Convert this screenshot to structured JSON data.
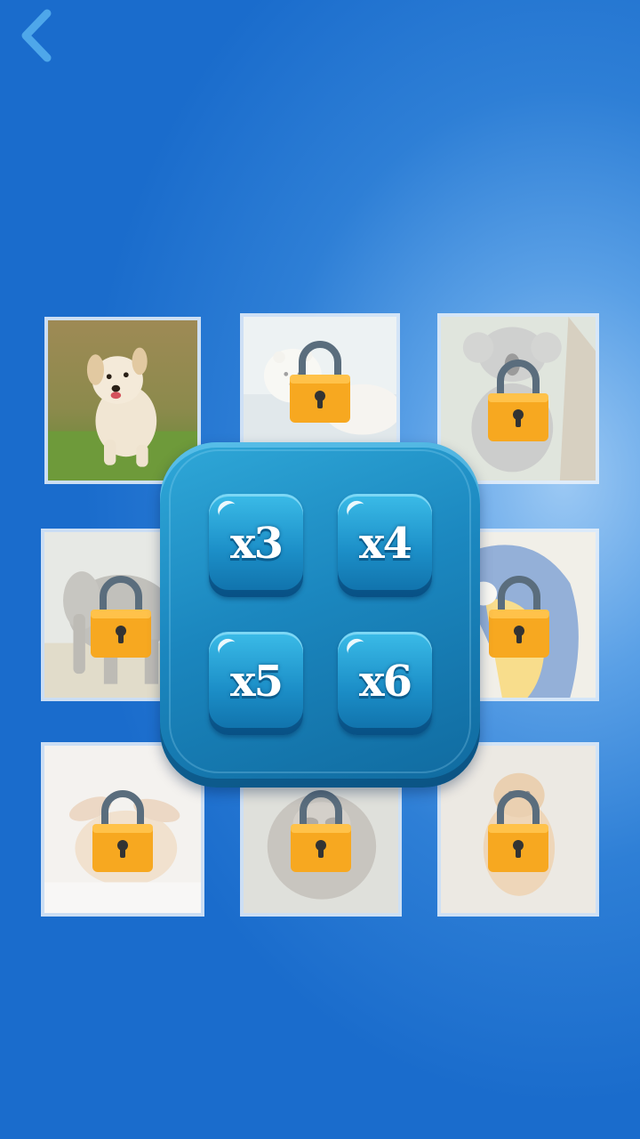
{
  "colors": {
    "background": "#2e7fd6",
    "panel": "#1b87bf",
    "button": "#1c8fc8",
    "lock_body": "#f7a820",
    "lock_shackle": "#5a6d7d"
  },
  "nav": {
    "back_icon": "chevron-left-icon"
  },
  "puzzles": [
    {
      "animal": "puppy",
      "locked": false
    },
    {
      "animal": "polar-bear",
      "locked": true
    },
    {
      "animal": "koala",
      "locked": true
    },
    {
      "animal": "elephant",
      "locked": true
    },
    {
      "animal": "hidden",
      "locked": true
    },
    {
      "animal": "parrot",
      "locked": true
    },
    {
      "animal": "bunny",
      "locked": true
    },
    {
      "animal": "raccoon",
      "locked": true
    },
    {
      "animal": "tiger-cub",
      "locked": true
    }
  ],
  "multiplier_menu": {
    "options": [
      "x3",
      "x4",
      "x5",
      "x6"
    ]
  }
}
